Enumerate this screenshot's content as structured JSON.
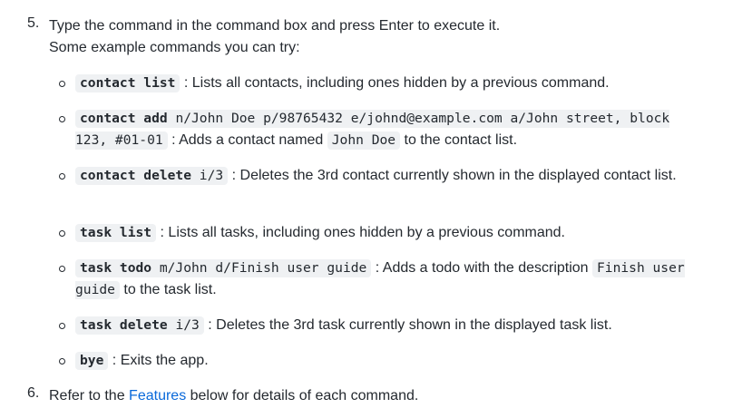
{
  "steps": {
    "step5": {
      "number": "5.",
      "line1": "Type the command in the command box and press Enter to execute it.",
      "line2": "Some example commands you can try:"
    },
    "step6": {
      "number": "6.",
      "prefix": "Refer to the ",
      "link": "Features",
      "suffix": " below for details of each command."
    }
  },
  "commands": [
    {
      "cmd": "contact list",
      "args": "",
      "desc": " : Lists all contacts, including ones hidden by a previous command."
    },
    {
      "cmd": "contact add",
      "args": " n/John Doe p/98765432 e/johnd@example.com a/John street, block 123, #01-01",
      "desc": " : Adds a contact named ",
      "code2": "John Doe",
      "desc2": " to the contact list."
    },
    {
      "cmd": "contact delete",
      "args": " i/3",
      "desc": " : Deletes the 3rd contact currently shown in the displayed contact list."
    },
    {
      "cmd": "task list",
      "args": "",
      "desc": " : Lists all tasks, including ones hidden by a previous command."
    },
    {
      "cmd": "task todo",
      "args": " m/John d/Finish user guide",
      "desc": " : Adds a todo with the description ",
      "code2": "Finish user guide",
      "desc2": " to the task list."
    },
    {
      "cmd": "task delete",
      "args": " i/3",
      "desc": " : Deletes the 3rd task currently shown in the displayed task list."
    },
    {
      "cmd": "bye",
      "args": "",
      "desc": " : Exits the app."
    }
  ]
}
